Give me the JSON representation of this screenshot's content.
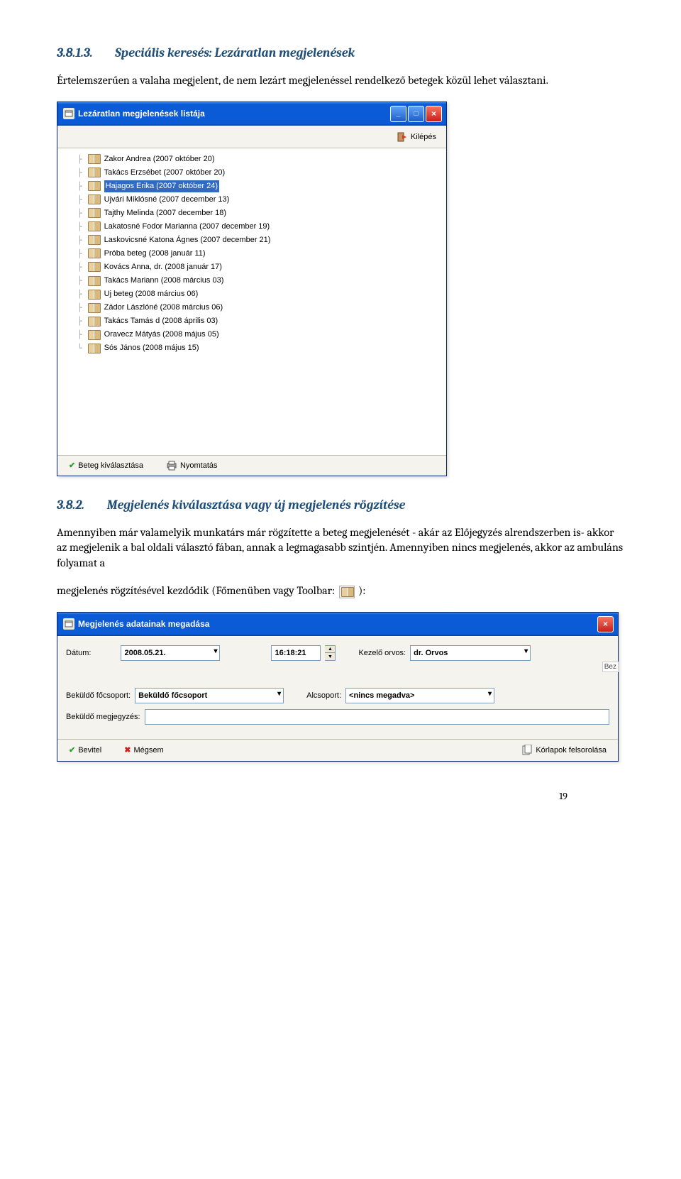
{
  "sections": {
    "s1": {
      "number": "3.8.1.3.",
      "title": "Speciális keresés: Lezáratlan megjelenések"
    },
    "s2": {
      "number": "3.8.2.",
      "title": "Megjelenés kiválasztása vagy új megjelenés rögzítése"
    }
  },
  "para1": "Értelemszerűen a valaha megjelent, de nem lezárt megjelenéssel rendelkező betegek közül lehet választani.",
  "para2": "Amennyiben már valamelyik munkatárs már rögzítette a beteg megjelenését - akár az Előjegyzés alrendszerben is- akkor az megjelenik a bal oldali választó fában, annak a legmagasabb szintjén. Amennyiben nincs megjelenés, akkor az ambuláns folyamat a",
  "para3_pre": "megjelenés rögzítésével kezdődik (Főmenüben vagy Toolbar: ",
  "para3_post": "):",
  "dialog1": {
    "title": "Lezáratlan megjelenések listája",
    "toolbar": {
      "exit": "Kilépés"
    },
    "tree_items": [
      "Zakor Andrea (2007 október 20)",
      "Takács Erzsébet (2007 október 20)",
      "Hajagos Erika (2007 október 24)",
      "Ujvári Miklósné (2007 december 13)",
      "Tajthy Melinda  (2007 december 18)",
      "Lakatosné Fodor Marianna  (2007 december 19)",
      "Laskovicsné Katona Ágnes (2007 december 21)",
      "Próba beteg (2008 január 11)",
      "Kovács Anna, dr. (2008 január 17)",
      "Takács Mariann (2008 március 03)",
      "Uj beteg (2008 március 06)",
      "Zádor Lászlóné (2008 március 06)",
      "Takács Tamás d (2008 április 03)",
      "Oravecz Mátyás (2008 május 05)",
      "Sós János (2008 május 15)"
    ],
    "selected_index": 2,
    "bottom": {
      "select": "Beteg kiválasztása",
      "print": "Nyomtatás"
    }
  },
  "dialog2": {
    "title": "Megjelenés adatainak megadása",
    "labels": {
      "date": "Dátum:",
      "time_sep": "",
      "doctor": "Kezelő orvos:",
      "sender_main": "Beküldő főcsoport:",
      "sender_sub": "Alcsoport:",
      "sender_note": "Beküldő megjegyzés:"
    },
    "values": {
      "date": "2008.05.21.",
      "time": "16:18:21",
      "doctor": "dr. Orvos",
      "sender_main": "Beküldő főcsoport",
      "sender_sub": "<nincs megadva>",
      "sender_note": ""
    },
    "badge": "Bez",
    "bottom": {
      "ok": "Bevitel",
      "cancel": "Mégsem",
      "pages": "Kórlapok felsorolása"
    }
  },
  "page_number": "19"
}
